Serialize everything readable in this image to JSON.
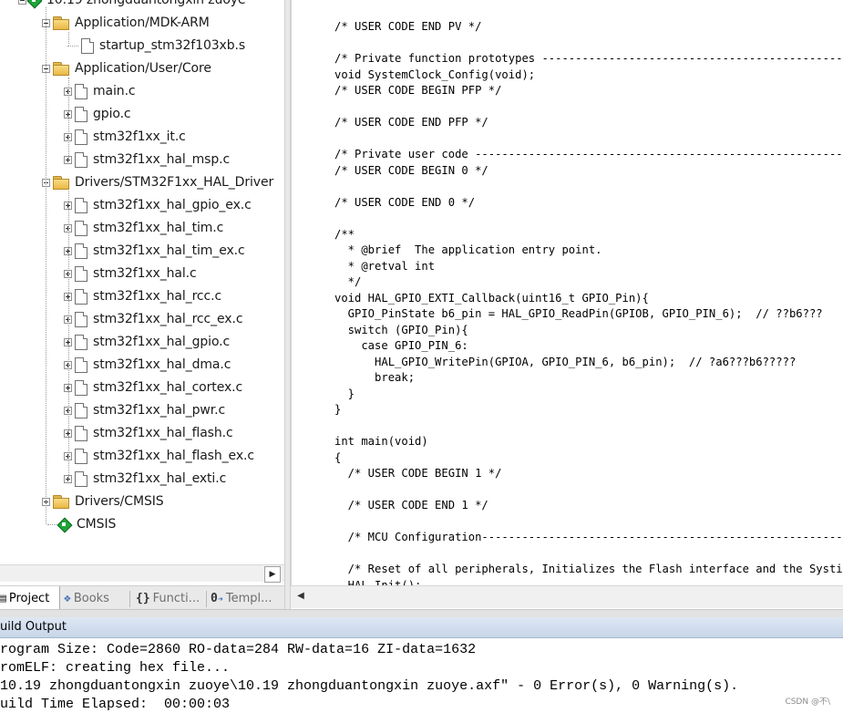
{
  "project_tree": {
    "root_label": "10.19 zhongduantongxin zuoye",
    "groups": [
      {
        "label": "Application/MDK-ARM",
        "files": [
          "startup_stm32f103xb.s"
        ]
      },
      {
        "label": "Application/User/Core",
        "files": [
          "main.c",
          "gpio.c",
          "stm32f1xx_it.c",
          "stm32f1xx_hal_msp.c"
        ]
      },
      {
        "label": "Drivers/STM32F1xx_HAL_Driver",
        "files": [
          "stm32f1xx_hal_gpio_ex.c",
          "stm32f1xx_hal_tim.c",
          "stm32f1xx_hal_tim_ex.c",
          "stm32f1xx_hal.c",
          "stm32f1xx_hal_rcc.c",
          "stm32f1xx_hal_rcc_ex.c",
          "stm32f1xx_hal_gpio.c",
          "stm32f1xx_hal_dma.c",
          "stm32f1xx_hal_cortex.c",
          "stm32f1xx_hal_pwr.c",
          "stm32f1xx_hal_flash.c",
          "stm32f1xx_hal_flash_ex.c",
          "stm32f1xx_hal_exti.c"
        ]
      },
      {
        "label": "Drivers/CMSIS",
        "files": []
      }
    ],
    "component_label": "CMSIS"
  },
  "panel_tabs": [
    {
      "label": "Project",
      "icon": "project-icon"
    },
    {
      "label": "Books",
      "icon": "books-icon"
    },
    {
      "label": "Functi...",
      "icon": "functions-icon"
    },
    {
      "label": "Templ...",
      "icon": "templates-icon"
    }
  ],
  "editor": {
    "lines": [
      "/* USER CODE END PV */",
      "",
      "/* Private function prototypes -----------------------------------------------*/",
      "void SystemClock_Config(void);",
      "/* USER CODE BEGIN PFP */",
      "",
      "/* USER CODE END PFP */",
      "",
      "/* Private user code ---------------------------------------------------------*/",
      "/* USER CODE BEGIN 0 */",
      "",
      "/* USER CODE END 0 */",
      "",
      "/**",
      "  * @brief  The application entry point.",
      "  * @retval int",
      "  */",
      "void HAL_GPIO_EXTI_Callback(uint16_t GPIO_Pin){",
      "  GPIO_PinState b6_pin = HAL_GPIO_ReadPin(GPIOB, GPIO_PIN_6);  // ??b6???",
      "  switch (GPIO_Pin){",
      "    case GPIO_PIN_6:",
      "      HAL_GPIO_WritePin(GPIOA, GPIO_PIN_6, b6_pin);  // ?a6???b6?????",
      "      break;",
      "  }",
      "}",
      "",
      "int main(void)",
      "{",
      "  /* USER CODE BEGIN 1 */",
      "",
      "  /* USER CODE END 1 */",
      "",
      "  /* MCU Configuration--------------------------------------------------------*/",
      "",
      "  /* Reset of all peripherals, Initializes the Flash interface and the Systick. */",
      "  HAL_Init();"
    ]
  },
  "build_output": {
    "title": "uild Output",
    "lines": [
      "rogram Size: Code=2860 RO-data=284 RW-data=16 ZI-data=1632",
      "romELF: creating hex file...",
      "10.19 zhongduantongxin zuoye\\10.19 zhongduantongxin zuoye.axf\" - 0 Error(s), 0 Warning(s).",
      "uild Time Elapsed:  00:00:03"
    ]
  },
  "watermark": "CSDN @不\\"
}
